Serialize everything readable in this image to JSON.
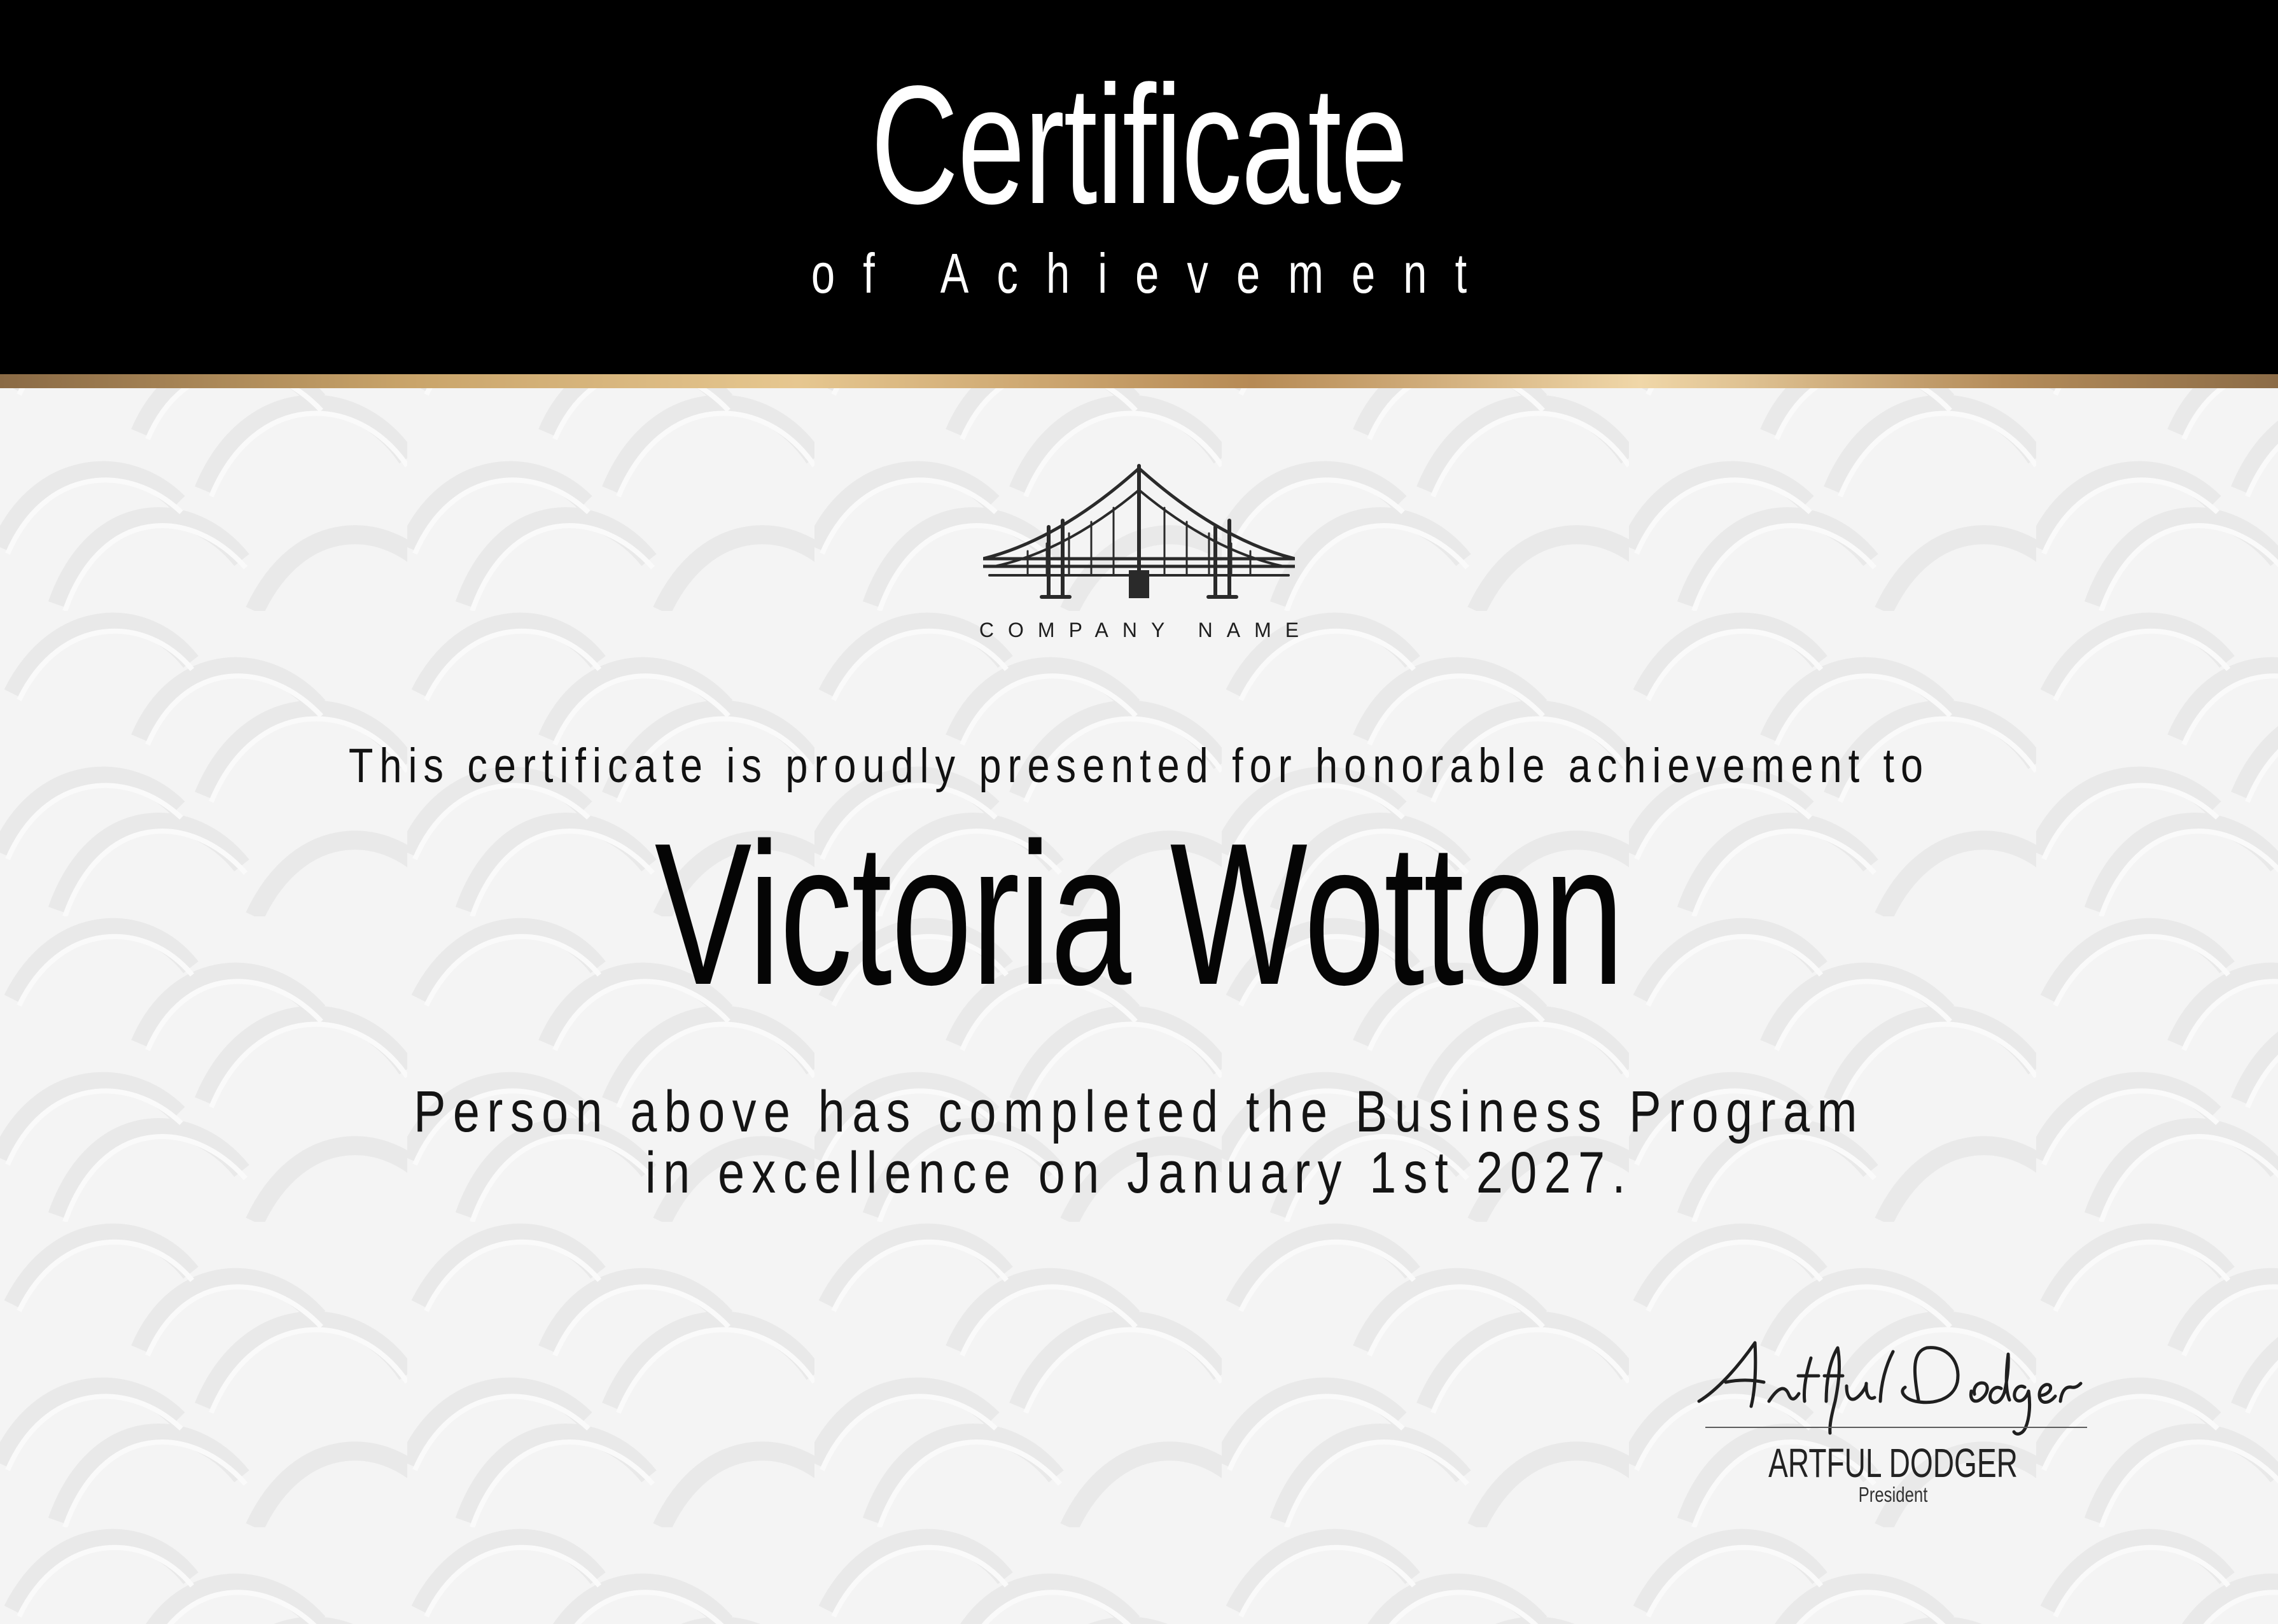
{
  "certificate": {
    "title": "Certificate",
    "subtitle": "of Achievement",
    "company_name": "COMPANY NAME",
    "presented_text": "This certificate is proudly presented for honorable achievement to",
    "recipient_name": "Victoria Wotton",
    "description_lines": [
      "Person above has completed the Business Program",
      "in excellence on January 1st 2027."
    ],
    "signature": {
      "handwritten": "Artful Dodger",
      "name": "ARTFUL DODGER",
      "title": "President"
    },
    "icons": {
      "logo": "bridge-logo-icon",
      "background": "curved-pattern-icon"
    },
    "colors": {
      "header_background": "#000000",
      "page_background": "#f4f4f4",
      "gold_accent": "#c9a46a",
      "text": "#111111"
    }
  }
}
